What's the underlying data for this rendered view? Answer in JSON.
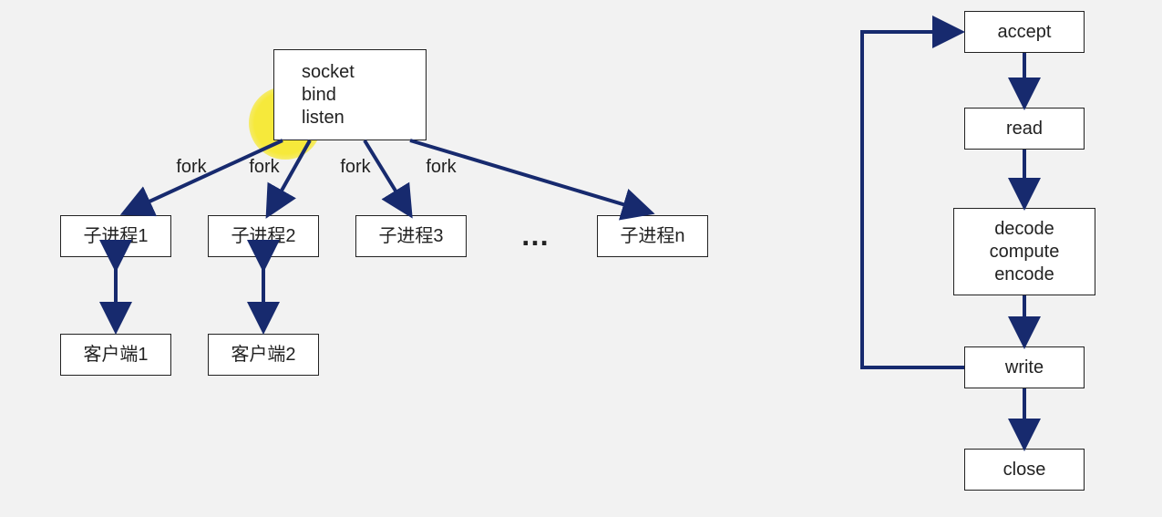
{
  "colors": {
    "arrow": "#172a6e",
    "highlight": "#f6e93b"
  },
  "left": {
    "root": {
      "line1": "socket",
      "line2": "bind",
      "line3": "listen"
    },
    "fork_labels": [
      "fork",
      "fork",
      "fork",
      "fork"
    ],
    "children": [
      "子进程1",
      "子进程2",
      "子进程3",
      "子进程n"
    ],
    "ellipsis": "…",
    "clients": [
      "客户端1",
      "客户端2"
    ]
  },
  "right": {
    "steps": [
      "accept",
      "read",
      "decode\ncompute\nencode",
      "write",
      "close"
    ]
  }
}
